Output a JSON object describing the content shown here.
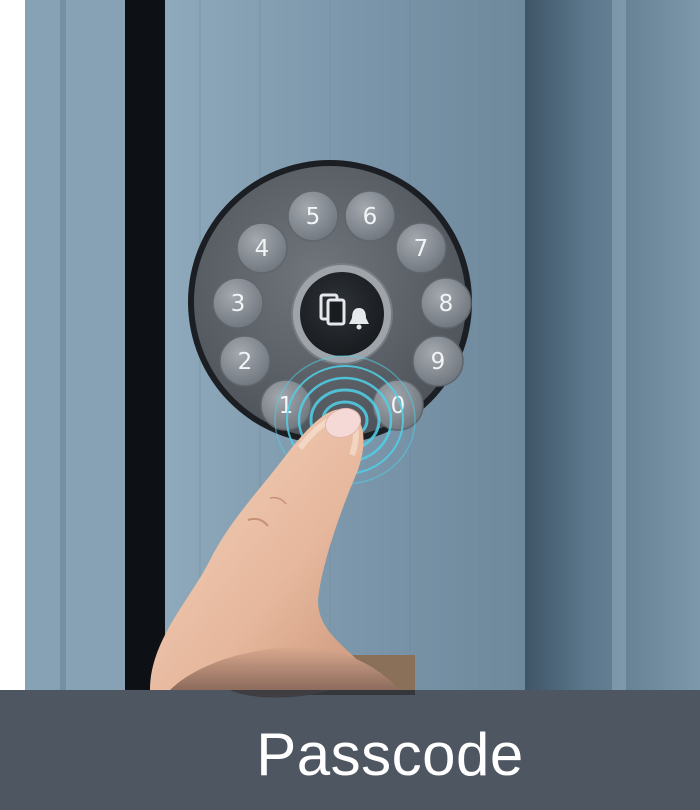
{
  "caption": {
    "text": "Passcode"
  },
  "keypad": {
    "keys": [
      "1",
      "2",
      "3",
      "4",
      "5",
      "6",
      "7",
      "8",
      "9",
      "0"
    ],
    "center_button_icon": "card-bell-icon"
  },
  "colors": {
    "door": "#7f9bb0",
    "door_dark": "#2c4152",
    "lock_body": "#5a5f66",
    "key": "#8c9299",
    "touch_ripple": "#4fd1e8",
    "caption_bg": "#1c2834"
  }
}
